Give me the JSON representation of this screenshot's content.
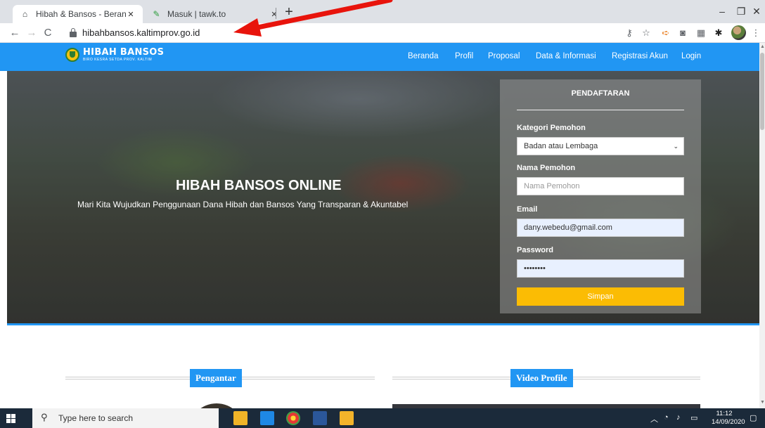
{
  "browser": {
    "tabs": [
      {
        "title": "Hibah & Bansos - Beranda - Indo",
        "icon": "house-icon"
      },
      {
        "title": "Masuk | tawk.to",
        "icon": "tawkto-icon"
      }
    ],
    "tab_close": "✕",
    "new_tab": "+",
    "window_controls": {
      "minimize": "–",
      "maximize": "❐",
      "close": "✕"
    },
    "address": "hibahbansos.kaltimprov.go.id",
    "nav": {
      "back": "←",
      "forward": "→",
      "reload": "C"
    }
  },
  "site": {
    "brand": {
      "name": "HIBAH BANSOS",
      "subtitle": "BIRO KESRA SETDA PROV. KALTIM"
    },
    "menu": [
      "Beranda",
      "Profil",
      "Proposal",
      "Data & Informasi",
      "Registrasi Akun",
      "Login"
    ],
    "hero": {
      "title": "HIBAH BANSOS ONLINE",
      "subtitle": "Mari Kita Wujudkan Penggunaan Dana Hibah dan Bansos Yang Transparan & Akuntabel"
    },
    "form": {
      "title": "PENDAFTARAN",
      "category_label": "Kategori Pemohon",
      "category_value": "Badan atau Lembaga",
      "name_label": "Nama Pemohon",
      "name_placeholder": "Nama Pemohon",
      "email_label": "Email",
      "email_value": "dany.webedu@gmail.com",
      "password_label": "Password",
      "password_value": "••••••••",
      "submit_label": "Simpan"
    },
    "sections": {
      "left": "Pengantar",
      "right": "Video Profile"
    }
  },
  "taskbar": {
    "search_placeholder": "Type here to search",
    "time": "11:12",
    "date": "14/09/2020"
  },
  "colors": {
    "primary": "#2196f3",
    "button": "#fbbc04",
    "annotation_arrow": "#e8140c"
  }
}
